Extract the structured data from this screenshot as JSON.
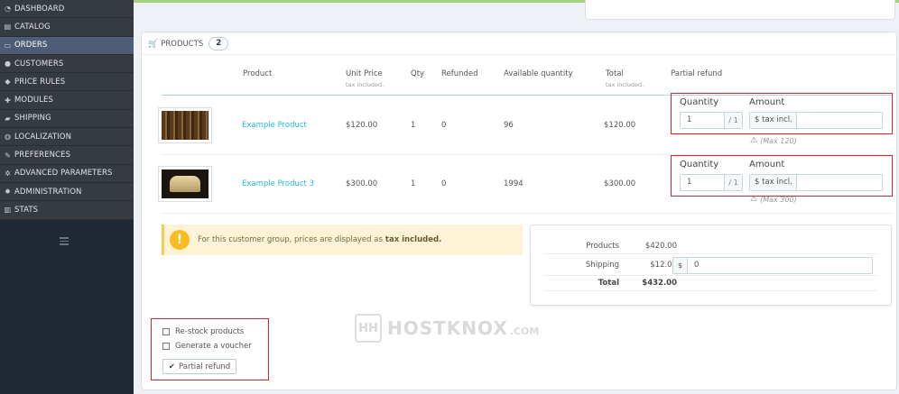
{
  "sidebar": {
    "items": [
      {
        "icon": "dashboard-icon",
        "glyph": "◔",
        "label": "DASHBOARD"
      },
      {
        "icon": "catalog-icon",
        "glyph": "▤",
        "label": "CATALOG"
      },
      {
        "icon": "orders-icon",
        "glyph": "▭",
        "label": "ORDERS",
        "active": true
      },
      {
        "icon": "customers-icon",
        "glyph": "●",
        "label": "CUSTOMERS"
      },
      {
        "icon": "price-rules-icon",
        "glyph": "◆",
        "label": "PRICE RULES"
      },
      {
        "icon": "modules-icon",
        "glyph": "✚",
        "label": "MODULES"
      },
      {
        "icon": "shipping-icon",
        "glyph": "▰",
        "label": "SHIPPING"
      },
      {
        "icon": "localization-icon",
        "glyph": "◍",
        "label": "LOCALIZATION"
      },
      {
        "icon": "preferences-icon",
        "glyph": "✎",
        "label": "PREFERENCES"
      },
      {
        "icon": "advanced-parameters-icon",
        "glyph": "✲",
        "label": "ADVANCED PARAMETERS"
      },
      {
        "icon": "administration-icon",
        "glyph": "✹",
        "label": "ADMINISTRATION"
      },
      {
        "icon": "stats-icon",
        "glyph": "▥",
        "label": "STATS"
      }
    ]
  },
  "products": {
    "title": "PRODUCTS",
    "count": "2",
    "columns": {
      "product": "Product",
      "unit_price": "Unit Price",
      "unit_price_note": "tax included.",
      "qty": "Qty",
      "refunded": "Refunded",
      "available": "Available quantity",
      "total": "Total",
      "total_note": "tax included.",
      "partial_refund": "Partial refund"
    },
    "rows": [
      {
        "name": "Example Product",
        "unit_price": "$120.00",
        "qty": "1",
        "refunded": "0",
        "available": "96",
        "total": "$120.00",
        "refund_qty_label": "Quantity",
        "refund_amount_label": "Amount",
        "refund_qty": "1",
        "refund_qty_max": "/ 1",
        "amount_addon": "$ tax incl.",
        "max_note": "(Max 120)"
      },
      {
        "name": "Example Product 3",
        "unit_price": "$300.00",
        "qty": "1",
        "refunded": "0",
        "available": "1994",
        "total": "$300.00",
        "refund_qty_label": "Quantity",
        "refund_amount_label": "Amount",
        "refund_qty": "1",
        "refund_qty_max": "/ 1",
        "amount_addon": "$ tax incl.",
        "max_note": "(Max 300)"
      }
    ]
  },
  "alert": {
    "text": "For this customer group, prices are displayed as",
    "emphasis": "tax included."
  },
  "totals": {
    "products_label": "Products",
    "products_value": "$420.00",
    "shipping_label": "Shipping",
    "shipping_value": "$12.00",
    "shipping_addon": "$",
    "shipping_input": "0",
    "total_label": "Total",
    "total_value": "$432.00"
  },
  "options": {
    "restock": "Re-stock products",
    "voucher": "Generate a voucher",
    "button": "Partial refund"
  },
  "watermark": {
    "logo": "HH",
    "word": "HOSTKNOX",
    "domain": ".COM"
  },
  "colors": {
    "accent": "#25b9d7",
    "highlight_border": "#d9252a",
    "sidebar": "#363a41"
  }
}
